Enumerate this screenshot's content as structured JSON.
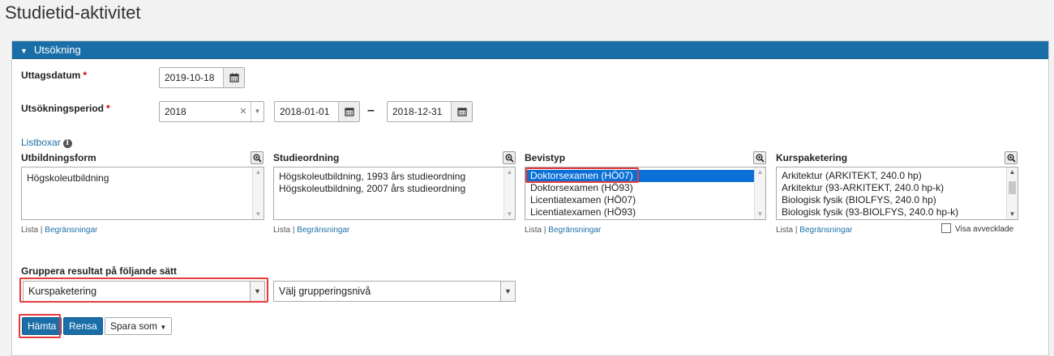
{
  "page": {
    "title": "Studietid-aktivitet"
  },
  "panel": {
    "title": "Utsökning"
  },
  "uttagsdatum": {
    "label": "Uttagsdatum",
    "value": "2019-10-18"
  },
  "period": {
    "label": "Utsökningsperiod",
    "year": "2018",
    "from": "2018-01-01",
    "dash": "–",
    "to": "2018-12-31"
  },
  "listboxar": {
    "title": "Listboxar",
    "sub_lista": "Lista",
    "sub_sep": "|",
    "sub_begr": "Begränsningar",
    "boxes": [
      {
        "label": "Utbildningsform",
        "items": [
          "Högskoleutbildning"
        ]
      },
      {
        "label": "Studieordning",
        "items": [
          "Högskoleutbildning, 1993 års studieordning",
          "Högskoleutbildning, 2007 års studieordning"
        ]
      },
      {
        "label": "Bevistyp",
        "items": [
          "Doktorsexamen (HÖ07)",
          "Doktorsexamen (HÖ93)",
          "Licentiatexamen (HÖ07)",
          "Licentiatexamen (HÖ93)"
        ]
      },
      {
        "label": "Kurspaketering",
        "items": [
          "Arkitektur (ARKITEKT, 240.0 hp)",
          "Arkitektur (93-ARKITEKT, 240.0 hp-k)",
          "Biologisk fysik (BIOLFYS, 240.0 hp)",
          "Biologisk fysik (93-BIOLFYS, 240.0 hp-k)"
        ]
      }
    ],
    "visa_avvecklade": "Visa avvecklade"
  },
  "gruppera": {
    "label": "Gruppera resultat på följande sätt",
    "select1": "Kurspaketering",
    "select2": "Välj grupperingsnivå"
  },
  "buttons": {
    "hamta": "Hämta",
    "rensa": "Rensa",
    "spara": "Spara som"
  },
  "icons": {
    "calendar": "calendar-icon",
    "zoom": "zoom-in-icon",
    "info": "info-icon",
    "caret": "caret-down-icon"
  },
  "colors": {
    "header_bg": "#1a6ea8",
    "selection": "#0a6fd6",
    "highlight": "#e53b3b",
    "required": "#cc0000"
  }
}
